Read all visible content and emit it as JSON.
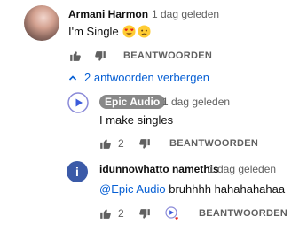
{
  "comment": {
    "author": "Armani Harmon",
    "timestamp": "1 dag geleden",
    "text": "I'm Single",
    "reply_label": "BEANTWOORDEN",
    "replies_toggle": "2 antwoorden verbergen"
  },
  "replies": [
    {
      "author": "Epic Audio",
      "timestamp": "1 dag geleden",
      "text": "I make singles",
      "likes": "2",
      "reply_label": "BEANTWOORDEN"
    },
    {
      "author": "idunnowhatto namethis",
      "avatar_letter": "i",
      "timestamp": "1 dag geleden",
      "mention": "@Epic Audio",
      "text": " bruhhhh hahahahahaa",
      "likes": "2",
      "reply_label": "BEANTWOORDEN"
    }
  ],
  "colors": {
    "link_blue": "#065fd4",
    "muted": "#606060",
    "heart_red": "#e62117"
  }
}
